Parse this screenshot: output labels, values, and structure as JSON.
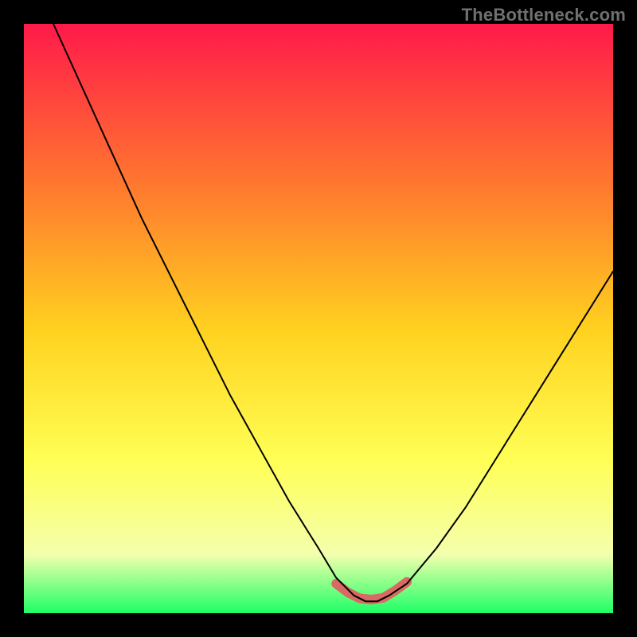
{
  "watermark": "TheBottleneck.com",
  "colors": {
    "frame": "#000000",
    "gradient_top": "#ff1a4a",
    "gradient_mid_upper": "#ff7a2e",
    "gradient_mid": "#ffd21f",
    "gradient_mid_lower": "#ffff55",
    "gradient_lower": "#f4ffad",
    "gradient_bottom": "#1dff66",
    "curve": "#000000",
    "highlight": "#d96a63"
  },
  "chart_data": {
    "type": "line",
    "title": "",
    "xlabel": "",
    "ylabel": "",
    "xlim": [
      0,
      100
    ],
    "ylim": [
      0,
      100
    ],
    "series": [
      {
        "name": "bottleneck-curve",
        "x": [
          5,
          10,
          15,
          20,
          25,
          30,
          35,
          40,
          45,
          50,
          53,
          56,
          58,
          60,
          62,
          65,
          70,
          75,
          80,
          85,
          90,
          95,
          100
        ],
        "y": [
          100,
          89,
          78,
          67,
          57,
          47,
          37,
          28,
          19,
          11,
          6,
          3,
          2,
          2,
          3,
          5,
          11,
          18,
          26,
          34,
          42,
          50,
          58
        ]
      },
      {
        "name": "minimum-highlight",
        "x": [
          53,
          55,
          57,
          59,
          61,
          63,
          65
        ],
        "y": [
          5,
          3.5,
          2.5,
          2.3,
          2.6,
          3.8,
          5.3
        ]
      }
    ],
    "legend": false,
    "grid": false
  }
}
